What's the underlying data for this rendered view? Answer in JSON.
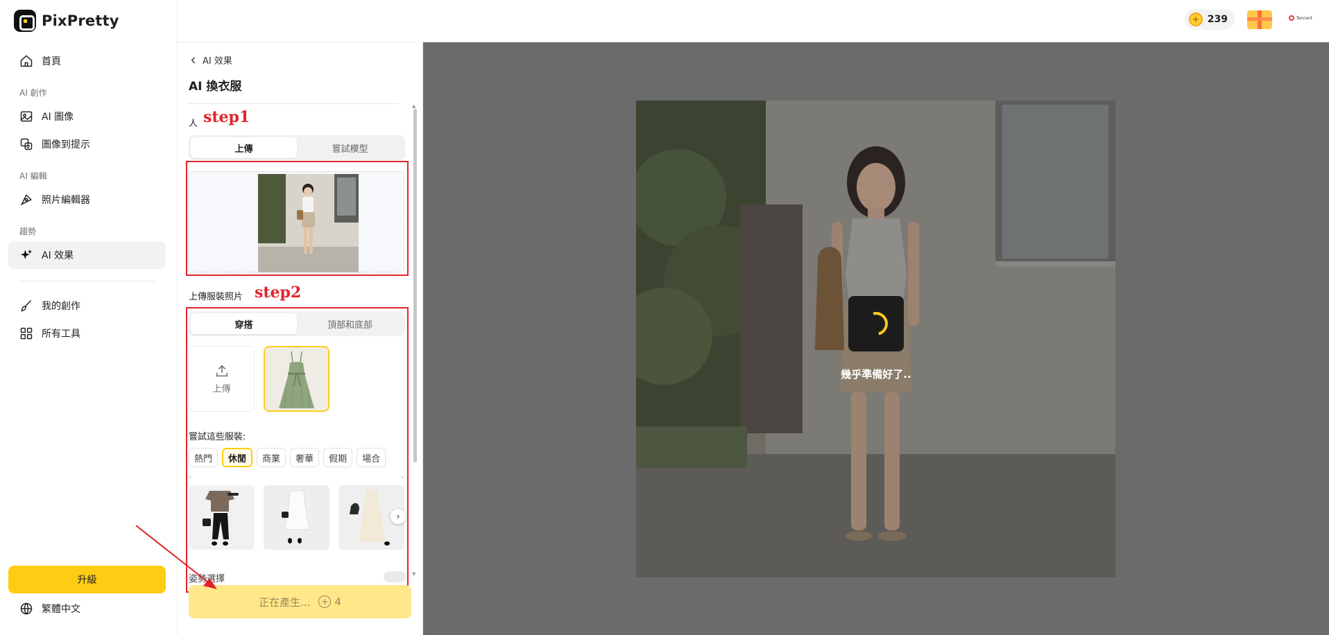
{
  "brand": {
    "name": "PixPretty"
  },
  "sidebar": {
    "home": "首頁",
    "section_create": "AI 創作",
    "ai_image": "AI 圖像",
    "image_to_prompt": "圖像到提示",
    "section_edit": "AI 編輯",
    "photo_editor": "照片編輯器",
    "section_trend": "趨勢",
    "ai_effects": "AI 效果",
    "my_creations": "我的創作",
    "all_tools": "所有工具",
    "upgrade": "升級",
    "language": "繁體中文"
  },
  "topbar": {
    "credits": "239",
    "partner": "Tencent"
  },
  "panel": {
    "back_label": "AI 效果",
    "title": "AI 換衣服",
    "person_label": "人",
    "step1": "step1",
    "person_tabs": [
      "上傳",
      "嘗試模型"
    ],
    "person_tab_selected": "上傳",
    "garment_label": "上傳服裝照片",
    "step2": "step2",
    "garment_tabs": [
      "穿搭",
      "頂部和底部"
    ],
    "garment_tab_selected": "穿搭",
    "upload_tile": "上傳",
    "try_label": "嘗試這些服裝:",
    "chips": [
      "熱門",
      "休閒",
      "商業",
      "奢華",
      "假期",
      "場合"
    ],
    "chip_selected": "休閒",
    "hidden_row": "姿勢選擇",
    "generate_label": "正在產生...",
    "generate_cost": "4"
  },
  "canvas": {
    "loading_text": "幾乎準備好了.."
  },
  "colors": {
    "accent": "#ffcc14",
    "annotation": "#e3232b",
    "canvas_bg": "#6b6b6b"
  }
}
